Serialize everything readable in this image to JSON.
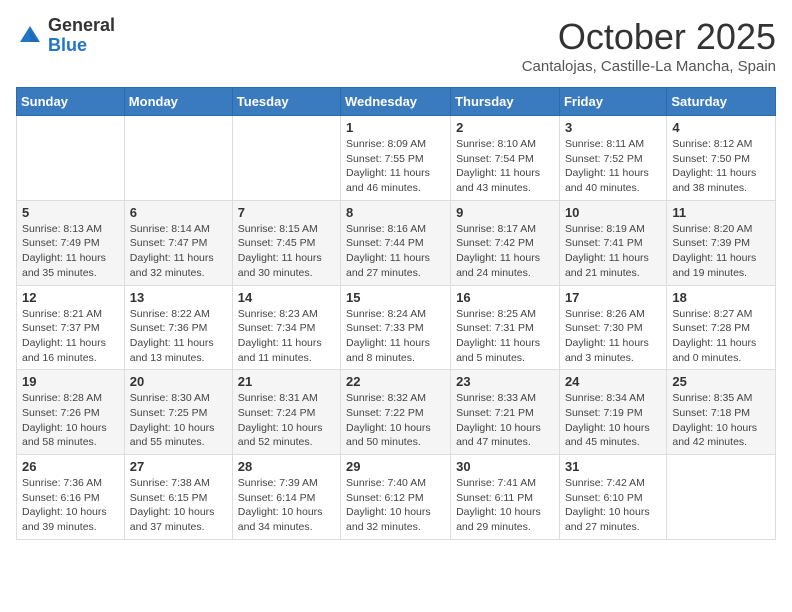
{
  "header": {
    "logo_line1": "General",
    "logo_line2": "Blue",
    "month": "October 2025",
    "location": "Cantalojas, Castille-La Mancha, Spain"
  },
  "weekdays": [
    "Sunday",
    "Monday",
    "Tuesday",
    "Wednesday",
    "Thursday",
    "Friday",
    "Saturday"
  ],
  "weeks": [
    [
      {
        "day": "",
        "info": ""
      },
      {
        "day": "",
        "info": ""
      },
      {
        "day": "",
        "info": ""
      },
      {
        "day": "1",
        "info": "Sunrise: 8:09 AM\nSunset: 7:55 PM\nDaylight: 11 hours and 46 minutes."
      },
      {
        "day": "2",
        "info": "Sunrise: 8:10 AM\nSunset: 7:54 PM\nDaylight: 11 hours and 43 minutes."
      },
      {
        "day": "3",
        "info": "Sunrise: 8:11 AM\nSunset: 7:52 PM\nDaylight: 11 hours and 40 minutes."
      },
      {
        "day": "4",
        "info": "Sunrise: 8:12 AM\nSunset: 7:50 PM\nDaylight: 11 hours and 38 minutes."
      }
    ],
    [
      {
        "day": "5",
        "info": "Sunrise: 8:13 AM\nSunset: 7:49 PM\nDaylight: 11 hours and 35 minutes."
      },
      {
        "day": "6",
        "info": "Sunrise: 8:14 AM\nSunset: 7:47 PM\nDaylight: 11 hours and 32 minutes."
      },
      {
        "day": "7",
        "info": "Sunrise: 8:15 AM\nSunset: 7:45 PM\nDaylight: 11 hours and 30 minutes."
      },
      {
        "day": "8",
        "info": "Sunrise: 8:16 AM\nSunset: 7:44 PM\nDaylight: 11 hours and 27 minutes."
      },
      {
        "day": "9",
        "info": "Sunrise: 8:17 AM\nSunset: 7:42 PM\nDaylight: 11 hours and 24 minutes."
      },
      {
        "day": "10",
        "info": "Sunrise: 8:19 AM\nSunset: 7:41 PM\nDaylight: 11 hours and 21 minutes."
      },
      {
        "day": "11",
        "info": "Sunrise: 8:20 AM\nSunset: 7:39 PM\nDaylight: 11 hours and 19 minutes."
      }
    ],
    [
      {
        "day": "12",
        "info": "Sunrise: 8:21 AM\nSunset: 7:37 PM\nDaylight: 11 hours and 16 minutes."
      },
      {
        "day": "13",
        "info": "Sunrise: 8:22 AM\nSunset: 7:36 PM\nDaylight: 11 hours and 13 minutes."
      },
      {
        "day": "14",
        "info": "Sunrise: 8:23 AM\nSunset: 7:34 PM\nDaylight: 11 hours and 11 minutes."
      },
      {
        "day": "15",
        "info": "Sunrise: 8:24 AM\nSunset: 7:33 PM\nDaylight: 11 hours and 8 minutes."
      },
      {
        "day": "16",
        "info": "Sunrise: 8:25 AM\nSunset: 7:31 PM\nDaylight: 11 hours and 5 minutes."
      },
      {
        "day": "17",
        "info": "Sunrise: 8:26 AM\nSunset: 7:30 PM\nDaylight: 11 hours and 3 minutes."
      },
      {
        "day": "18",
        "info": "Sunrise: 8:27 AM\nSunset: 7:28 PM\nDaylight: 11 hours and 0 minutes."
      }
    ],
    [
      {
        "day": "19",
        "info": "Sunrise: 8:28 AM\nSunset: 7:26 PM\nDaylight: 10 hours and 58 minutes."
      },
      {
        "day": "20",
        "info": "Sunrise: 8:30 AM\nSunset: 7:25 PM\nDaylight: 10 hours and 55 minutes."
      },
      {
        "day": "21",
        "info": "Sunrise: 8:31 AM\nSunset: 7:24 PM\nDaylight: 10 hours and 52 minutes."
      },
      {
        "day": "22",
        "info": "Sunrise: 8:32 AM\nSunset: 7:22 PM\nDaylight: 10 hours and 50 minutes."
      },
      {
        "day": "23",
        "info": "Sunrise: 8:33 AM\nSunset: 7:21 PM\nDaylight: 10 hours and 47 minutes."
      },
      {
        "day": "24",
        "info": "Sunrise: 8:34 AM\nSunset: 7:19 PM\nDaylight: 10 hours and 45 minutes."
      },
      {
        "day": "25",
        "info": "Sunrise: 8:35 AM\nSunset: 7:18 PM\nDaylight: 10 hours and 42 minutes."
      }
    ],
    [
      {
        "day": "26",
        "info": "Sunrise: 7:36 AM\nSunset: 6:16 PM\nDaylight: 10 hours and 39 minutes."
      },
      {
        "day": "27",
        "info": "Sunrise: 7:38 AM\nSunset: 6:15 PM\nDaylight: 10 hours and 37 minutes."
      },
      {
        "day": "28",
        "info": "Sunrise: 7:39 AM\nSunset: 6:14 PM\nDaylight: 10 hours and 34 minutes."
      },
      {
        "day": "29",
        "info": "Sunrise: 7:40 AM\nSunset: 6:12 PM\nDaylight: 10 hours and 32 minutes."
      },
      {
        "day": "30",
        "info": "Sunrise: 7:41 AM\nSunset: 6:11 PM\nDaylight: 10 hours and 29 minutes."
      },
      {
        "day": "31",
        "info": "Sunrise: 7:42 AM\nSunset: 6:10 PM\nDaylight: 10 hours and 27 minutes."
      },
      {
        "day": "",
        "info": ""
      }
    ]
  ]
}
